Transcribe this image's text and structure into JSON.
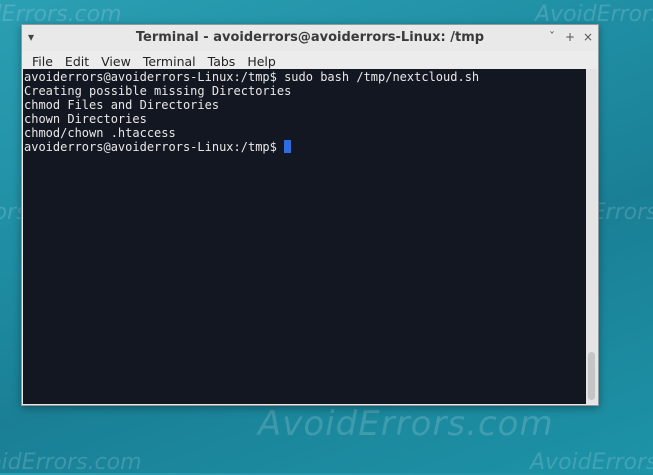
{
  "watermark": {
    "text": "AvoidErrors.com"
  },
  "window": {
    "title": "Terminal - avoiderrors@avoiderrors-Linux: /tmp",
    "controls": {
      "minimize": "ˇ",
      "maximize": "+",
      "close": "×"
    }
  },
  "menubar": {
    "items": [
      "File",
      "Edit",
      "View",
      "Terminal",
      "Tabs",
      "Help"
    ]
  },
  "terminal": {
    "lines": [
      "avoiderrors@avoiderrors-Linux:/tmp$ sudo bash /tmp/nextcloud.sh",
      "Creating possible missing Directories",
      "chmod Files and Directories",
      "chown Directories",
      "chmod/chown .htaccess"
    ],
    "prompt": "avoiderrors@avoiderrors-Linux:/tmp$ "
  }
}
